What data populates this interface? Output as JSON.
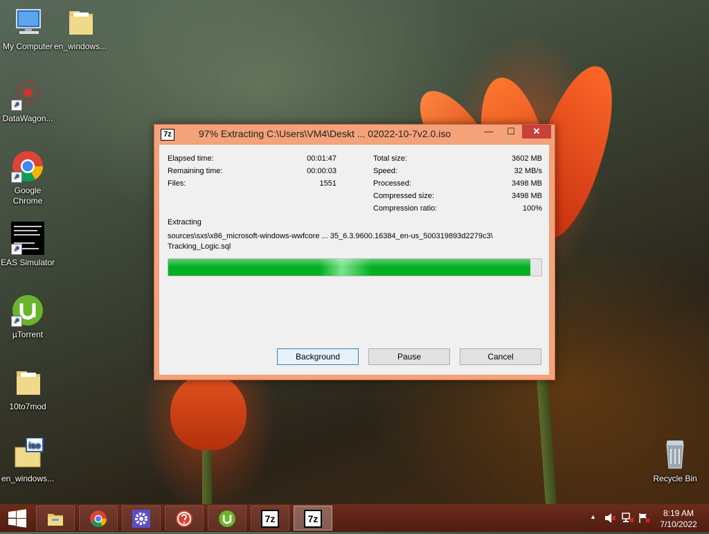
{
  "desktop": {
    "icons": [
      {
        "label": "My Computer"
      },
      {
        "label": "en_windows..."
      },
      {
        "label": "DataWagon..."
      },
      {
        "label": "Google Chrome"
      },
      {
        "label": "EAS Simulator"
      },
      {
        "label": "µTorrent"
      },
      {
        "label": "10to7mod"
      },
      {
        "label": "en_windows..."
      },
      {
        "label": "Recycle Bin"
      }
    ],
    "shortcut_glyph": "↗",
    "iso_badge": "iso"
  },
  "dialog": {
    "app_icon": "7z",
    "title": "97% Extracting C:\\Users\\VM4\\Deskt ... 02022-10-7v2.0.iso",
    "controls": {
      "minimize": "—",
      "maximize": "☐",
      "close": "✕"
    },
    "stats_left": [
      {
        "label": "Elapsed time:",
        "value": "00:01:47"
      },
      {
        "label": "Remaining time:",
        "value": "00:00:03"
      },
      {
        "label": "Files:",
        "value": "1551"
      }
    ],
    "stats_right": [
      {
        "label": "Total size:",
        "value": "3602 MB"
      },
      {
        "label": "Speed:",
        "value": "32 MB/s"
      },
      {
        "label": "Processed:",
        "value": "3498 MB"
      },
      {
        "label": "Compressed size:",
        "value": "3498 MB"
      },
      {
        "label": "Compression ratio:",
        "value": "100%"
      }
    ],
    "status_label": "Extracting",
    "path_line1": "sources\\sxs\\x86_microsoft-windows-wwfcore ... 35_6.3.9600.16384_en-us_500319893d2279c3\\",
    "path_line2": "Tracking_Logic.sql",
    "progress": 0.97,
    "buttons": {
      "background": "Background",
      "pause": "Pause",
      "cancel": "Cancel"
    }
  },
  "taskbar": {
    "time": "8:19 AM",
    "date": "7/10/2022",
    "tray_arrow": "▲",
    "app_labels": {
      "7zip": "7z"
    }
  },
  "colors": {
    "progress_fill": "#06b025",
    "dialog_frame": "#f3a27a",
    "close_button": "#c7403a",
    "taskbar": "#5a2414"
  }
}
